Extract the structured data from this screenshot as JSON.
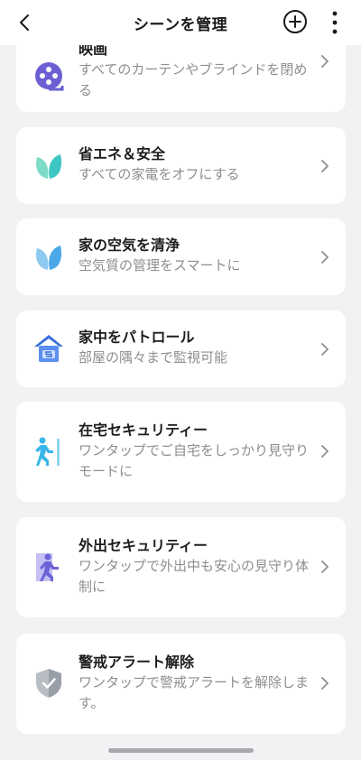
{
  "header": {
    "title": "シーンを管理"
  },
  "scenes": [
    {
      "name": "映画",
      "desc": "すべてのカーテンやブラインドを閉める",
      "icon": "film-reel-icon"
    },
    {
      "name": "省エネ＆安全",
      "desc": "すべての家電をオフにする",
      "icon": "leaf-icon"
    },
    {
      "name": "家の空気を清浄",
      "desc": "空気質の管理をスマートに",
      "icon": "leaf-icon"
    },
    {
      "name": "家中をパトロール",
      "desc": "部屋の隅々まで監視可能",
      "icon": "house-patrol-icon"
    },
    {
      "name": "在宅セキュリティー",
      "desc": "ワンタップでご自宅をしっかり見守りモードに",
      "icon": "person-at-home-icon"
    },
    {
      "name": "外出セキュリティー",
      "desc": "ワンタップで外出中も安心の見守り体制に",
      "icon": "person-leaving-icon"
    },
    {
      "name": "警戒アラート解除",
      "desc": "ワンタップで警戒アラートを解除します。",
      "icon": "shield-check-icon"
    }
  ],
  "colors": {
    "background": "#f2f2f4",
    "card": "#ffffff",
    "title_text": "#1d1d1f",
    "desc_text": "#8e8e93",
    "film_icon": "#6b5fd3",
    "leaf_icon": "#3ec7c2",
    "leaf2_icon": "#4aa8e8",
    "house_icon": "#3b6fd8",
    "person_icon": "#39b5e8",
    "person2_icon": "#6c63d9",
    "shield_icon": "#9aa0a8"
  }
}
